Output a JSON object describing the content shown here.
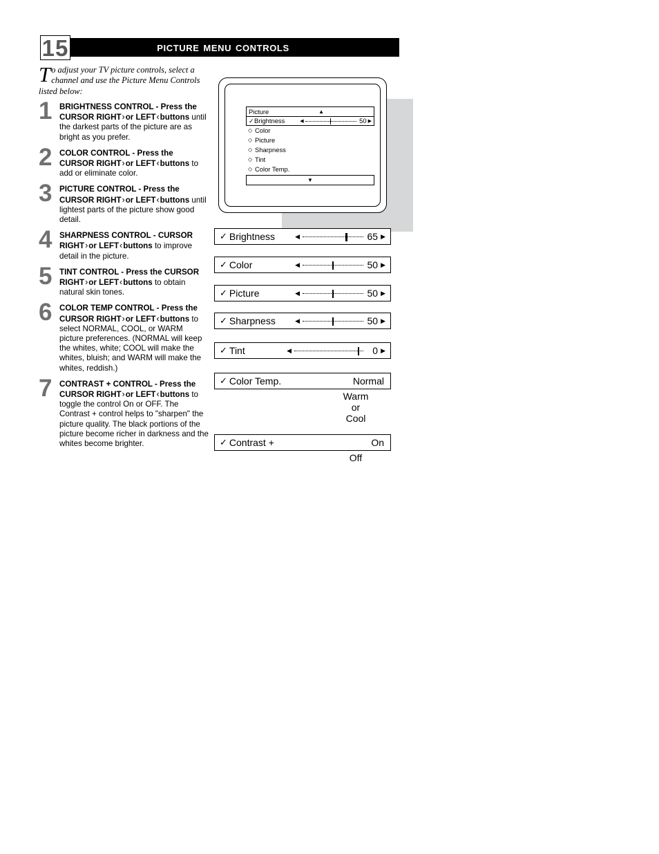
{
  "page": {
    "number": "15",
    "title": "Picture Menu Controls"
  },
  "intro": {
    "dropcap": "T",
    "text": "o adjust your TV picture controls, select a channel and use the Picture Menu Controls listed below:"
  },
  "steps": [
    {
      "number": "1",
      "title": "BRIGHTNESS CONTROL -",
      "bold_line": "Press the CURSOR RIGHT",
      "bold_line2": "or LEFT",
      "bold_line3": "buttons",
      "body": "until the darkest parts of the picture are as bright as you prefer."
    },
    {
      "number": "2",
      "title": "COLOR CONTROL - Press the",
      "bold_line": "CURSOR RIGHT",
      "bold_line2": "or LEFT",
      "bold_line3": "buttons",
      "body": "to add or eliminate color."
    },
    {
      "number": "3",
      "title": "PICTURE CONTROL - Press",
      "bold_line": "the CURSOR RIGHT",
      "bold_line2": "or LEFT",
      "bold_line3": "buttons",
      "body": "until lightest parts of the picture show good detail."
    },
    {
      "number": "4",
      "title": "SHARPNESS CONTROL -",
      "bold_line": "CURSOR RIGHT",
      "bold_line2": "or LEFT",
      "bold_line3": "buttons",
      "body": "to improve detail in the picture."
    },
    {
      "number": "5",
      "title": "TINT CONTROL - Press the",
      "bold_line": "CURSOR RIGHT",
      "bold_line2": "or LEFT",
      "bold_line3": "buttons",
      "body": "to obtain natural skin tones."
    },
    {
      "number": "6",
      "title": "COLOR TEMP CONTROL -",
      "bold_line": "Press the CURSOR RIGHT",
      "bold_line2": "or LEFT",
      "bold_line3": "buttons",
      "body": "to select NORMAL, COOL, or WARM picture preferences. (NORMAL will keep the whites, white; COOL will make the whites, bluish; and WARM will make the whites, reddish.)"
    },
    {
      "number": "7",
      "title": "CONTRAST + CONTROL -",
      "bold_line": "Press the CURSOR RIGHT",
      "bold_line2": "or LEFT",
      "bold_line3": "buttons",
      "body": "to toggle the control On or OFF. The Contrast + control helps to \"sharpen\" the picture quality. The black portions of the picture become richer in darkness and the whites become brighter."
    }
  ],
  "osd": {
    "header_label": "Picture",
    "scroll_up_icon": "▲",
    "scroll_down_icon": "▼",
    "highlight": {
      "check_icon": "✓",
      "label": "Brightness",
      "left_icon": "◀",
      "right_icon": "▶",
      "value": "50",
      "knob_percent": 50
    },
    "items": [
      {
        "bullet_icon": "◇",
        "label": "Color"
      },
      {
        "bullet_icon": "◇",
        "label": "Picture"
      },
      {
        "bullet_icon": "◇",
        "label": "Sharpness"
      },
      {
        "bullet_icon": "◇",
        "label": "Tint"
      },
      {
        "bullet_icon": "◇",
        "label": "Color Temp."
      }
    ]
  },
  "controls": [
    {
      "kind": "slider",
      "check_icon": "✓",
      "label": "Brightness",
      "left_icon": "◀",
      "right_icon": "▶",
      "value": "65",
      "knob_percent": 72,
      "track_width": 88
    },
    {
      "kind": "slider",
      "check_icon": "✓",
      "label": "Color",
      "left_icon": "◀",
      "right_icon": "▶",
      "value": "50",
      "knob_percent": 50,
      "track_width": 88
    },
    {
      "kind": "slider",
      "check_icon": "✓",
      "label": "Picture",
      "left_icon": "◀",
      "right_icon": "▶",
      "value": "50",
      "knob_percent": 50,
      "track_width": 88
    },
    {
      "kind": "slider",
      "check_icon": "✓",
      "label": "Sharpness",
      "left_icon": "◀",
      "right_icon": "▶",
      "value": "50",
      "knob_percent": 50,
      "track_width": 88
    },
    {
      "kind": "slider",
      "check_icon": "✓",
      "label": "Tint",
      "left_icon": "◀",
      "right_icon": "▶",
      "value": "0",
      "knob_percent": 93,
      "track_width": 100
    },
    {
      "kind": "option",
      "check_icon": "✓",
      "label": "Color Temp.",
      "value": "Normal",
      "alternates": [
        "Warm",
        "or",
        "Cool"
      ]
    },
    {
      "kind": "option",
      "check_icon": "✓",
      "label": "Contrast +",
      "value": "On",
      "alternates": [
        "Off"
      ]
    }
  ]
}
